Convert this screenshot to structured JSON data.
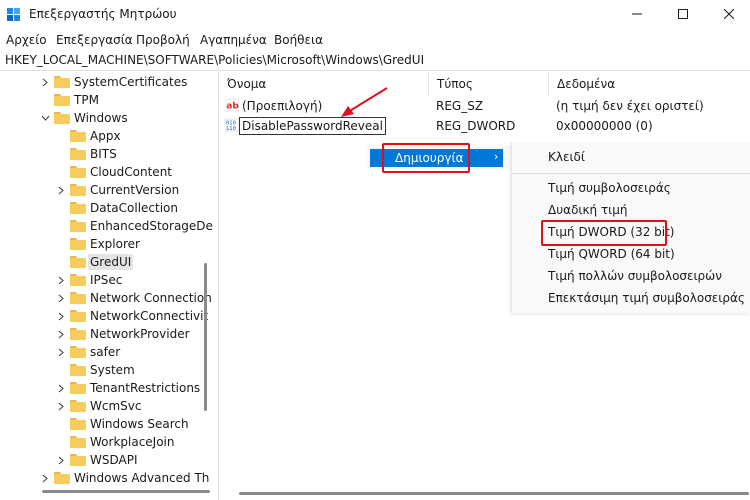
{
  "window": {
    "title": "Επεξεργαστής Μητρώου",
    "controls": {
      "minimize": "minimize-icon",
      "maximize": "maximize-icon",
      "close": "close-icon"
    }
  },
  "menu": {
    "items": [
      "Αρχείο",
      "Επεξεργασία",
      "Προβολή",
      "Αγαπημένα",
      "Βοήθεια"
    ]
  },
  "address": {
    "path": "HKEY_LOCAL_MACHINE\\SOFTWARE\\Policies\\Microsoft\\Windows\\GredUI"
  },
  "tree": {
    "items": [
      {
        "label": "SystemCertificates",
        "expand": "collapsed"
      },
      {
        "label": "TPM",
        "expand": "none"
      },
      {
        "label": "Windows",
        "expand": "expanded"
      },
      {
        "label": "Appx",
        "expand": "none"
      },
      {
        "label": "BITS",
        "expand": "none"
      },
      {
        "label": "CloudContent",
        "expand": "none"
      },
      {
        "label": "CurrentVersion",
        "expand": "collapsed"
      },
      {
        "label": "DataCollection",
        "expand": "none"
      },
      {
        "label": "EnhancedStorageDe",
        "expand": "none"
      },
      {
        "label": "Explorer",
        "expand": "none"
      },
      {
        "label": "GredUI",
        "expand": "none",
        "selected": true
      },
      {
        "label": "IPSec",
        "expand": "collapsed"
      },
      {
        "label": "Network Connection",
        "expand": "collapsed"
      },
      {
        "label": "NetworkConnectivit",
        "expand": "collapsed"
      },
      {
        "label": "NetworkProvider",
        "expand": "collapsed"
      },
      {
        "label": "safer",
        "expand": "collapsed"
      },
      {
        "label": "System",
        "expand": "none"
      },
      {
        "label": "TenantRestrictions",
        "expand": "collapsed"
      },
      {
        "label": "WcmSvc",
        "expand": "collapsed"
      },
      {
        "label": "Windows Search",
        "expand": "none"
      },
      {
        "label": "WorkplaceJoin",
        "expand": "none"
      },
      {
        "label": "WSDAPI",
        "expand": "collapsed"
      },
      {
        "label": "Windows Advanced Th",
        "expand": "collapsed"
      }
    ]
  },
  "list": {
    "columns": [
      "Όνομα",
      "Τύπος",
      "Δεδομένα"
    ],
    "rows": [
      {
        "icon": "string-value-icon",
        "name": "(Προεπιλογή)",
        "type": "REG_SZ",
        "data": "(η τιμή δεν έχει οριστεί)"
      },
      {
        "icon": "binary-value-icon",
        "name": "DisablePasswordReveal",
        "type": "REG_DWORD",
        "data": "0x00000000 (0)",
        "editing": true
      }
    ]
  },
  "context_menu": {
    "new_label": "Δημιουργία",
    "arrow": "›"
  },
  "submenu": {
    "key": "Κλειδί",
    "values": [
      "Τιμή συμβολοσειράς",
      "Δυαδική τιμή",
      "Τιμή DWORD (32 bit)",
      "Τιμή QWORD (64 bit)",
      "Τιμή πολλών συμβολοσειρών",
      "Επεκτάσιμη τιμή συμβολοσειράς"
    ]
  },
  "annotations": {
    "highlight_color": "#e0101f",
    "selection_color": "#0078d7"
  }
}
